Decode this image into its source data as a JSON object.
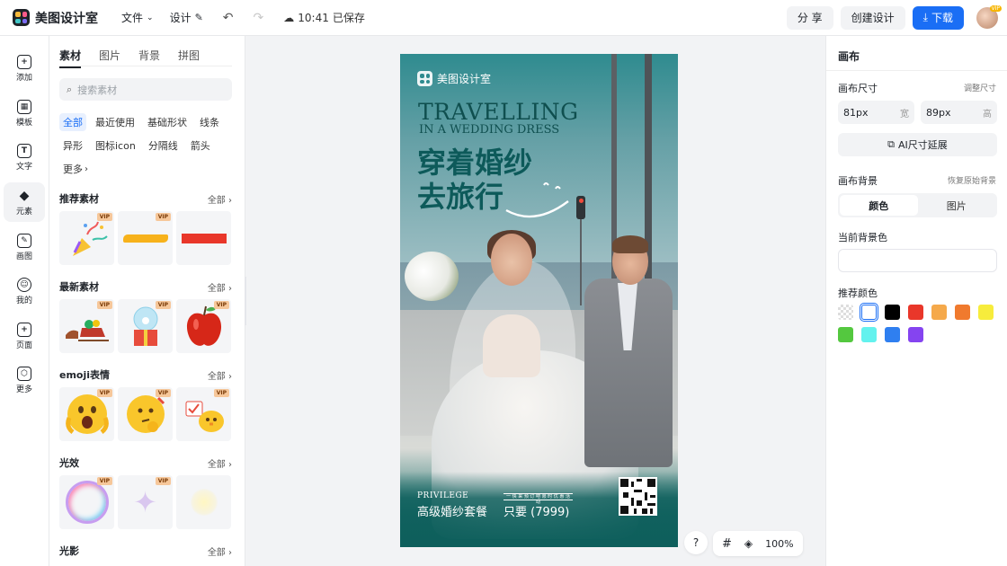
{
  "app": {
    "name": "美图设计室"
  },
  "topbar": {
    "menu": [
      {
        "label": "文件",
        "icon": "chevron-down-icon"
      },
      {
        "label": "设计",
        "icon": "edit-icon"
      }
    ],
    "save_time": "10:41",
    "save_status": "已保存",
    "share_label": "分 享",
    "create_label": "创建设计",
    "download_label": "下载",
    "avatar_badge": "VIP"
  },
  "leftnav": {
    "items": [
      {
        "label": "添加",
        "icon": "plus-icon"
      },
      {
        "label": "模板",
        "icon": "template-icon"
      },
      {
        "label": "文字",
        "icon": "text-icon"
      },
      {
        "label": "元素",
        "icon": "element-icon"
      },
      {
        "label": "画图",
        "icon": "draw-icon"
      },
      {
        "label": "我的",
        "icon": "user-icon"
      },
      {
        "label": "页面",
        "icon": "page-icon"
      },
      {
        "label": "更多",
        "icon": "more-icon"
      }
    ],
    "active": "元素"
  },
  "panel": {
    "tabs": [
      "素材",
      "图片",
      "背景",
      "拼图"
    ],
    "active_tab": "素材",
    "search_placeholder": "搜索素材",
    "chips": [
      "全部",
      "最近使用",
      "基础形状",
      "线条",
      "异形",
      "图标icon",
      "分隔线",
      "箭头",
      "更多"
    ],
    "active_chip": "全部",
    "sections": [
      {
        "title": "推荐素材",
        "all": "全部",
        "thumbs": [
          "party-popper",
          "yellow-brush-stroke",
          "red-rectangle"
        ],
        "vip": [
          true,
          true,
          false
        ]
      },
      {
        "title": "最新素材",
        "all": "全部",
        "thumbs": [
          "reindeer-sleigh",
          "snow-globe-gift",
          "red-apple"
        ],
        "vip": [
          true,
          true,
          true
        ]
      },
      {
        "title": "emoji表情",
        "all": "全部",
        "thumbs": [
          "shocked-emoji",
          "thinking-emoji",
          "chick-emoji"
        ],
        "vip": [
          true,
          true,
          true
        ]
      },
      {
        "title": "光效",
        "all": "全部",
        "thumbs": [
          "bubble-ring",
          "sparkle-star",
          "glow-light"
        ],
        "vip": [
          true,
          true,
          false
        ]
      },
      {
        "title": "光影",
        "all": "全部",
        "thumbs": [],
        "vip": []
      }
    ],
    "vip_label": "VIP"
  },
  "poster": {
    "brand": "美图设计室",
    "title_line1": "TRAVELLING",
    "title_line2": "IN A WEDDING DRESS",
    "headline_line1": "穿着婚纱",
    "headline_line2": "去旅行",
    "privilege": "PRIVILEGE",
    "package": "高级婚纱套餐",
    "price_label": "一 快 来 预 订 吧 限 时 优 惠 活 动",
    "price": "只要 (7999)"
  },
  "canvas_tools": {
    "help": "?",
    "zoom": "100%"
  },
  "rightpanel": {
    "title": "画布",
    "size_label": "画布尺寸",
    "size_link": "调整尺寸",
    "width_value": "81px",
    "width_unit": "宽",
    "height_value": "89px",
    "height_unit": "高",
    "ai_button": "AI尺寸延展",
    "bg_label": "画布背景",
    "bg_link": "恢复原始背景",
    "seg": [
      "颜色",
      "图片"
    ],
    "seg_active": "颜色",
    "current_color_label": "当前背景色",
    "current_color": "#ffffff",
    "recommend_label": "推荐颜色",
    "swatches": [
      "transparent",
      "#ffffff",
      "#000000",
      "#e9372a",
      "#f5a94b",
      "#f07a2e",
      "#f7ec3c",
      "#54c83f",
      "#63f2ee",
      "#2f7ff0",
      "#8544f0"
    ],
    "selected_swatch": "#ffffff"
  }
}
